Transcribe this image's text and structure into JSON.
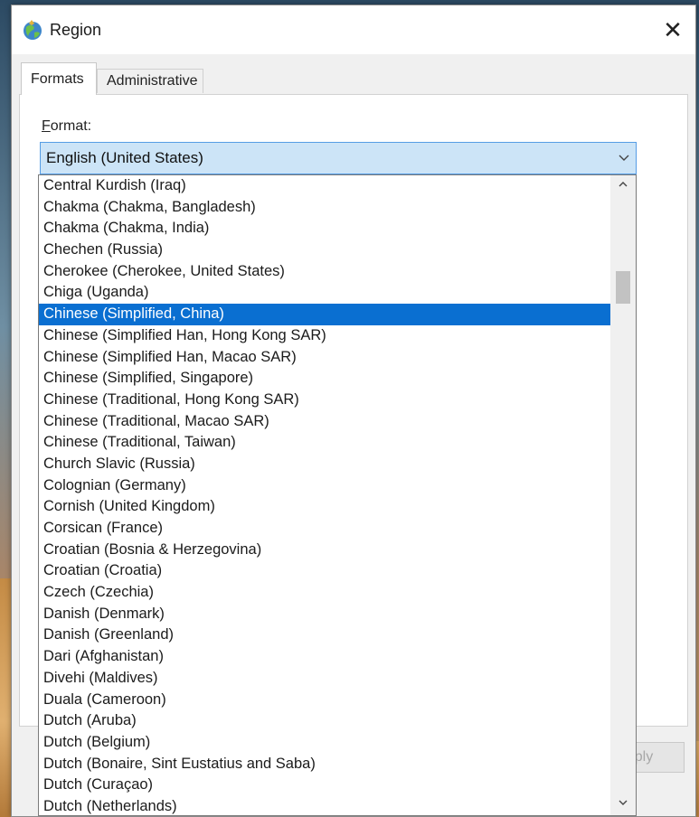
{
  "window": {
    "title": "Region",
    "close_glyph": "✕"
  },
  "tabs": [
    {
      "label": "Formats",
      "active": true
    },
    {
      "label": "Administrative",
      "active": false
    }
  ],
  "format": {
    "label_accel": "F",
    "label_rest": "ormat:",
    "selected_value": "English (United States)"
  },
  "dropdown": {
    "items": [
      "Central Kurdish (Iraq)",
      "Chakma (Chakma, Bangladesh)",
      "Chakma (Chakma, India)",
      "Chechen (Russia)",
      "Cherokee (Cherokee, United States)",
      "Chiga (Uganda)",
      "Chinese (Simplified, China)",
      "Chinese (Simplified Han, Hong Kong SAR)",
      "Chinese (Simplified Han, Macao SAR)",
      "Chinese (Simplified, Singapore)",
      "Chinese (Traditional, Hong Kong SAR)",
      "Chinese (Traditional, Macao SAR)",
      "Chinese (Traditional, Taiwan)",
      "Church Slavic (Russia)",
      "Colognian (Germany)",
      "Cornish (United Kingdom)",
      "Corsican (France)",
      "Croatian (Bosnia & Herzegovina)",
      "Croatian (Croatia)",
      "Czech (Czechia)",
      "Danish (Denmark)",
      "Danish (Greenland)",
      "Dari (Afghanistan)",
      "Divehi (Maldives)",
      "Duala (Cameroon)",
      "Dutch (Aruba)",
      "Dutch (Belgium)",
      "Dutch (Bonaire, Sint Eustatius and Saba)",
      "Dutch (Curaçao)",
      "Dutch (Netherlands)"
    ],
    "selected_index": 6
  },
  "footer": {
    "apply_label_partial": "ply"
  },
  "colors": {
    "selection": "#0a6fd1",
    "combo_fill": "#cce4f7",
    "combo_border": "#569de5"
  }
}
